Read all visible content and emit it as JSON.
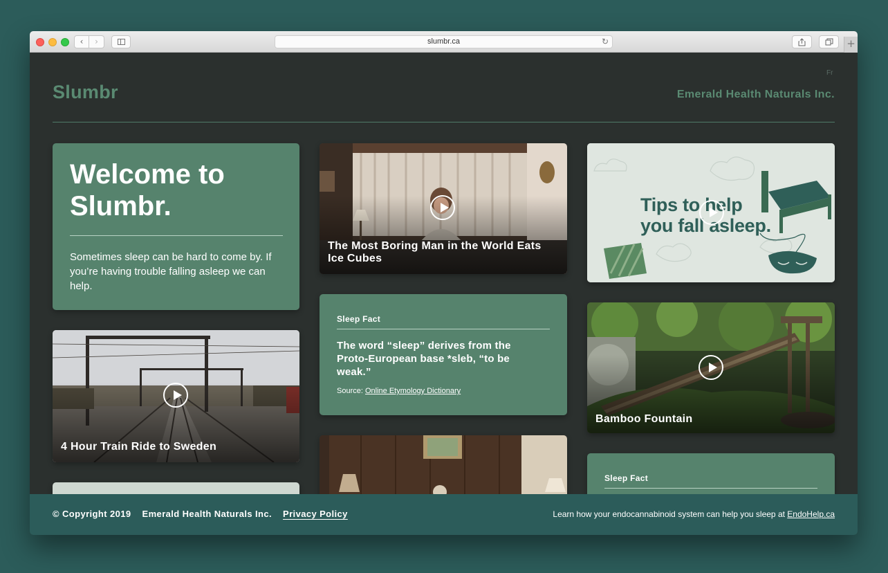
{
  "browser": {
    "url": "slumbr.ca"
  },
  "site": {
    "logo": "Slumbr",
    "lang_toggle": "Fr",
    "company": "Emerald Health Naturals Inc."
  },
  "welcome": {
    "title": "Welcome to Slumbr.",
    "body": "Sometimes sleep can be hard to come by. If you’re having trouble falling asleep we can help."
  },
  "videos": [
    {
      "title": "The Most Boring Man in the World Eats Ice Cubes"
    },
    {
      "title": "4 Hour Train Ride to Sweden"
    },
    {
      "title": "Bamboo Fountain"
    }
  ],
  "tips": {
    "line1": "Tips to help",
    "line2": "you fall asleep."
  },
  "facts": [
    {
      "label": "Sleep Fact",
      "text": "The word “sleep” derives from the Proto-European base *sleb, “to be weak.”",
      "source_prefix": "Source: ",
      "source_link": "Online Etymology Dictionary"
    },
    {
      "label": "Sleep Fact"
    }
  ],
  "footer": {
    "copyright": "© Copyright 2019",
    "company": "Emerald Health Naturals Inc.",
    "privacy": "Privacy Policy",
    "learn_text": "Learn how your endocannabinoid system can help you sleep at ",
    "learn_link": "EndoHelp.ca"
  },
  "colors": {
    "page_bg": "#2b302e",
    "accent_green": "#56836d",
    "logo_green": "#5a8a72",
    "footer_teal": "#2c5c5a"
  }
}
